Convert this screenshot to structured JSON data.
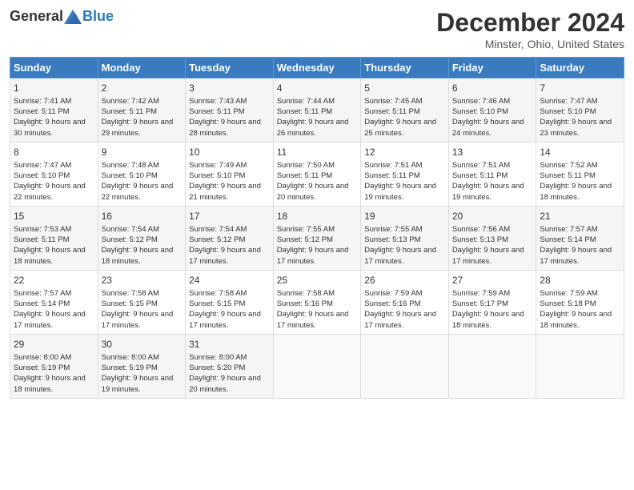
{
  "header": {
    "logo_general": "General",
    "logo_blue": "Blue",
    "month": "December 2024",
    "location": "Minster, Ohio, United States"
  },
  "days_of_week": [
    "Sunday",
    "Monday",
    "Tuesday",
    "Wednesday",
    "Thursday",
    "Friday",
    "Saturday"
  ],
  "weeks": [
    [
      {
        "day": "1",
        "info": "Sunrise: 7:41 AM\nSunset: 5:11 PM\nDaylight: 9 hours and 30 minutes."
      },
      {
        "day": "2",
        "info": "Sunrise: 7:42 AM\nSunset: 5:11 PM\nDaylight: 9 hours and 29 minutes."
      },
      {
        "day": "3",
        "info": "Sunrise: 7:43 AM\nSunset: 5:11 PM\nDaylight: 9 hours and 28 minutes."
      },
      {
        "day": "4",
        "info": "Sunrise: 7:44 AM\nSunset: 5:11 PM\nDaylight: 9 hours and 26 minutes."
      },
      {
        "day": "5",
        "info": "Sunrise: 7:45 AM\nSunset: 5:11 PM\nDaylight: 9 hours and 25 minutes."
      },
      {
        "day": "6",
        "info": "Sunrise: 7:46 AM\nSunset: 5:10 PM\nDaylight: 9 hours and 24 minutes."
      },
      {
        "day": "7",
        "info": "Sunrise: 7:47 AM\nSunset: 5:10 PM\nDaylight: 9 hours and 23 minutes."
      }
    ],
    [
      {
        "day": "8",
        "info": "Sunrise: 7:47 AM\nSunset: 5:10 PM\nDaylight: 9 hours and 22 minutes."
      },
      {
        "day": "9",
        "info": "Sunrise: 7:48 AM\nSunset: 5:10 PM\nDaylight: 9 hours and 22 minutes."
      },
      {
        "day": "10",
        "info": "Sunrise: 7:49 AM\nSunset: 5:10 PM\nDaylight: 9 hours and 21 minutes."
      },
      {
        "day": "11",
        "info": "Sunrise: 7:50 AM\nSunset: 5:11 PM\nDaylight: 9 hours and 20 minutes."
      },
      {
        "day": "12",
        "info": "Sunrise: 7:51 AM\nSunset: 5:11 PM\nDaylight: 9 hours and 19 minutes."
      },
      {
        "day": "13",
        "info": "Sunrise: 7:51 AM\nSunset: 5:11 PM\nDaylight: 9 hours and 19 minutes."
      },
      {
        "day": "14",
        "info": "Sunrise: 7:52 AM\nSunset: 5:11 PM\nDaylight: 9 hours and 18 minutes."
      }
    ],
    [
      {
        "day": "15",
        "info": "Sunrise: 7:53 AM\nSunset: 5:11 PM\nDaylight: 9 hours and 18 minutes."
      },
      {
        "day": "16",
        "info": "Sunrise: 7:54 AM\nSunset: 5:12 PM\nDaylight: 9 hours and 18 minutes."
      },
      {
        "day": "17",
        "info": "Sunrise: 7:54 AM\nSunset: 5:12 PM\nDaylight: 9 hours and 17 minutes."
      },
      {
        "day": "18",
        "info": "Sunrise: 7:55 AM\nSunset: 5:12 PM\nDaylight: 9 hours and 17 minutes."
      },
      {
        "day": "19",
        "info": "Sunrise: 7:55 AM\nSunset: 5:13 PM\nDaylight: 9 hours and 17 minutes."
      },
      {
        "day": "20",
        "info": "Sunrise: 7:56 AM\nSunset: 5:13 PM\nDaylight: 9 hours and 17 minutes."
      },
      {
        "day": "21",
        "info": "Sunrise: 7:57 AM\nSunset: 5:14 PM\nDaylight: 9 hours and 17 minutes."
      }
    ],
    [
      {
        "day": "22",
        "info": "Sunrise: 7:57 AM\nSunset: 5:14 PM\nDaylight: 9 hours and 17 minutes."
      },
      {
        "day": "23",
        "info": "Sunrise: 7:58 AM\nSunset: 5:15 PM\nDaylight: 9 hours and 17 minutes."
      },
      {
        "day": "24",
        "info": "Sunrise: 7:58 AM\nSunset: 5:15 PM\nDaylight: 9 hours and 17 minutes."
      },
      {
        "day": "25",
        "info": "Sunrise: 7:58 AM\nSunset: 5:16 PM\nDaylight: 9 hours and 17 minutes."
      },
      {
        "day": "26",
        "info": "Sunrise: 7:59 AM\nSunset: 5:16 PM\nDaylight: 9 hours and 17 minutes."
      },
      {
        "day": "27",
        "info": "Sunrise: 7:59 AM\nSunset: 5:17 PM\nDaylight: 9 hours and 18 minutes."
      },
      {
        "day": "28",
        "info": "Sunrise: 7:59 AM\nSunset: 5:18 PM\nDaylight: 9 hours and 18 minutes."
      }
    ],
    [
      {
        "day": "29",
        "info": "Sunrise: 8:00 AM\nSunset: 5:19 PM\nDaylight: 9 hours and 18 minutes."
      },
      {
        "day": "30",
        "info": "Sunrise: 8:00 AM\nSunset: 5:19 PM\nDaylight: 9 hours and 19 minutes."
      },
      {
        "day": "31",
        "info": "Sunrise: 8:00 AM\nSunset: 5:20 PM\nDaylight: 9 hours and 20 minutes."
      },
      {
        "day": "",
        "info": ""
      },
      {
        "day": "",
        "info": ""
      },
      {
        "day": "",
        "info": ""
      },
      {
        "day": "",
        "info": ""
      }
    ]
  ]
}
